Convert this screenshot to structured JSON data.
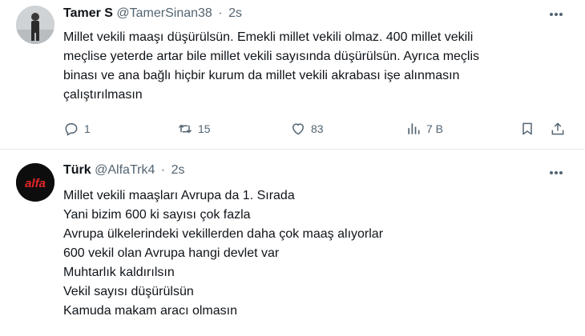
{
  "tweets": [
    {
      "name": "Tamer S",
      "handle": "@TamerSinan38",
      "separator": "·",
      "time": "2s",
      "lines": [
        "Millet vekili maaşı düşürülsün. Emekli millet vekili olmaz. 400 millet vekili",
        "meçlise yeterde artar bile millet vekili sayısında düşürülsün. Ayrıca meçlis",
        "binası ve ana bağlı hiçbir kurum da millet vekili akrabası işe alınmasın",
        "çalıştırılmasın"
      ],
      "stats": {
        "replies": "1",
        "retweets": "15",
        "likes": "83",
        "views": "7 B"
      },
      "icons": [
        "reply-icon",
        "retweet-icon",
        "like-icon",
        "views-icon",
        "bookmark-icon",
        "share-icon",
        "more-icon"
      ]
    },
    {
      "name": "Türk",
      "handle": "@AlfaTrk4",
      "separator": "·",
      "time": "2s",
      "avatar_text": "alfa",
      "lines": [
        "Millet vekili maaşları Avrupa da 1. Sırada",
        "Yani bizim 600 ki sayısı çok fazla",
        "Avrupa ülkelerindeki vekillerden daha çok maaş alıyorlar",
        "600 vekil olan Avrupa hangi devlet var",
        "Muhtarlık kaldırılsın",
        "Vekil sayısı düşürülsün",
        "Kamuda makam aracı olmasın"
      ]
    }
  ],
  "colors": {
    "text_primary": "#0f1419",
    "text_secondary": "#536471",
    "divider": "#e7e9ea",
    "alfa_red": "#e4262a"
  }
}
